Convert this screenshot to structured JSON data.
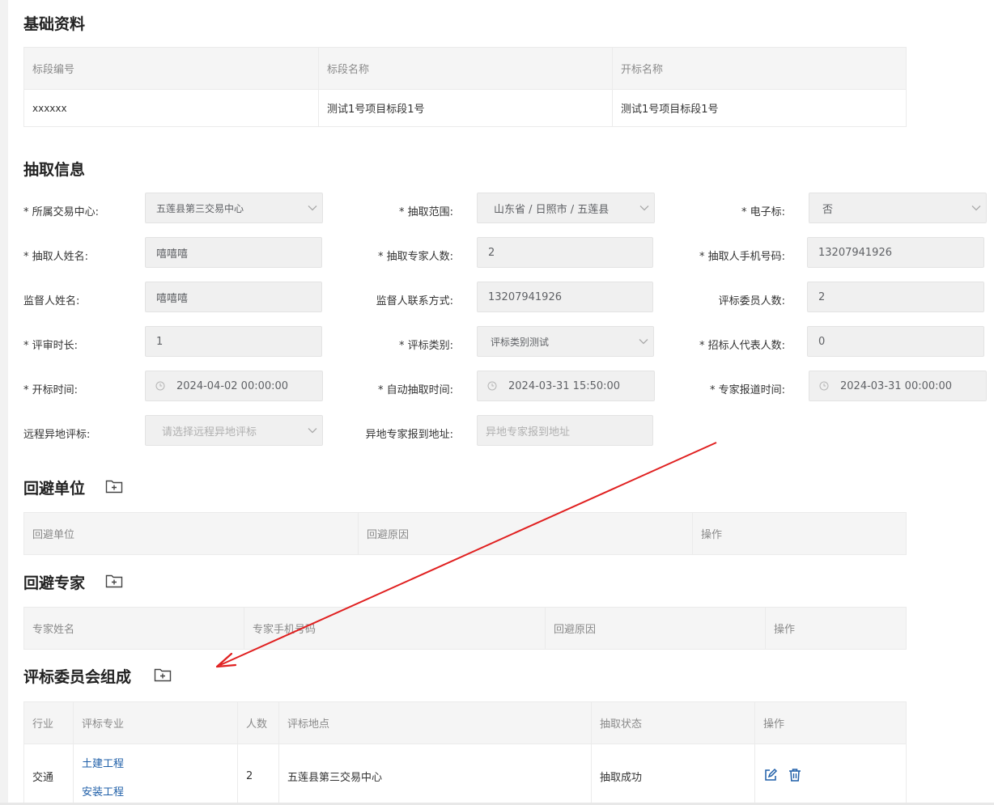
{
  "basic": {
    "title": "基础资料",
    "headers": [
      "标段编号",
      "标段名称",
      "开标名称"
    ],
    "values": [
      "xxxxxx",
      "测试1号项目标段1号",
      "测试1号项目标段1号"
    ]
  },
  "draw": {
    "title": "抽取信息",
    "fields": {
      "center": {
        "label": "* 所属交易中心:",
        "value": "五莲县第三交易中心"
      },
      "scope": {
        "label": "* 抽取范围:",
        "value": "山东省 / 日照市 / 五莲县"
      },
      "electronic": {
        "label": "* 电子标:",
        "value": "否"
      },
      "drawer_name": {
        "label": "* 抽取人姓名:",
        "value": "嘻嘻嘻"
      },
      "expert_count": {
        "label": "* 抽取专家人数:",
        "value": "2"
      },
      "drawer_phone": {
        "label": "* 抽取人手机号码:",
        "value": "13207941926"
      },
      "supervisor_name": {
        "label": "监督人姓名:",
        "value": "嘻嘻嘻"
      },
      "supervisor_contact": {
        "label": "监督人联系方式:",
        "value": "13207941926"
      },
      "committee_count": {
        "label": "评标委员人数:",
        "value": "2"
      },
      "review_duration": {
        "label": "* 评审时长:",
        "value": "1"
      },
      "eval_category": {
        "label": "* 评标类别:",
        "value": "评标类别测试"
      },
      "tenderer_rep_count": {
        "label": "* 招标人代表人数:",
        "value": "0"
      },
      "open_time": {
        "label": "* 开标时间:",
        "value": "2024-04-02 00:00:00"
      },
      "auto_draw_time": {
        "label": "* 自动抽取时间:",
        "value": "2024-03-31 15:50:00"
      },
      "report_time": {
        "label": "* 专家报道时间:",
        "value": "2024-03-31 00:00:00"
      },
      "remote_eval": {
        "label": "远程异地评标:",
        "placeholder": "请选择远程异地评标"
      },
      "remote_address": {
        "label": "异地专家报到地址:",
        "placeholder": "异地专家报到地址"
      }
    }
  },
  "avoid_unit": {
    "title": "回避单位",
    "headers": [
      "回避单位",
      "回避原因",
      "操作"
    ]
  },
  "avoid_expert": {
    "title": "回避专家",
    "headers": [
      "专家姓名",
      "专家手机号码",
      "回避原因",
      "操作"
    ]
  },
  "committee": {
    "title": "评标委员会组成",
    "headers": [
      "行业",
      "评标专业",
      "人数",
      "评标地点",
      "抽取状态",
      "操作"
    ],
    "row": {
      "industry": "交通",
      "specialties": [
        "土建工程",
        "安装工程"
      ],
      "count": "2",
      "location": "五莲县第三交易中心",
      "status": "抽取成功"
    }
  },
  "icons": {
    "folder_add": "folder-plus-icon",
    "edit": "edit-icon",
    "delete": "trash-icon",
    "select": "chevron-down-icon",
    "time": "clock-icon"
  },
  "colors": {
    "link": "#1f5fa8",
    "annotation_arrow": "#e02020"
  }
}
